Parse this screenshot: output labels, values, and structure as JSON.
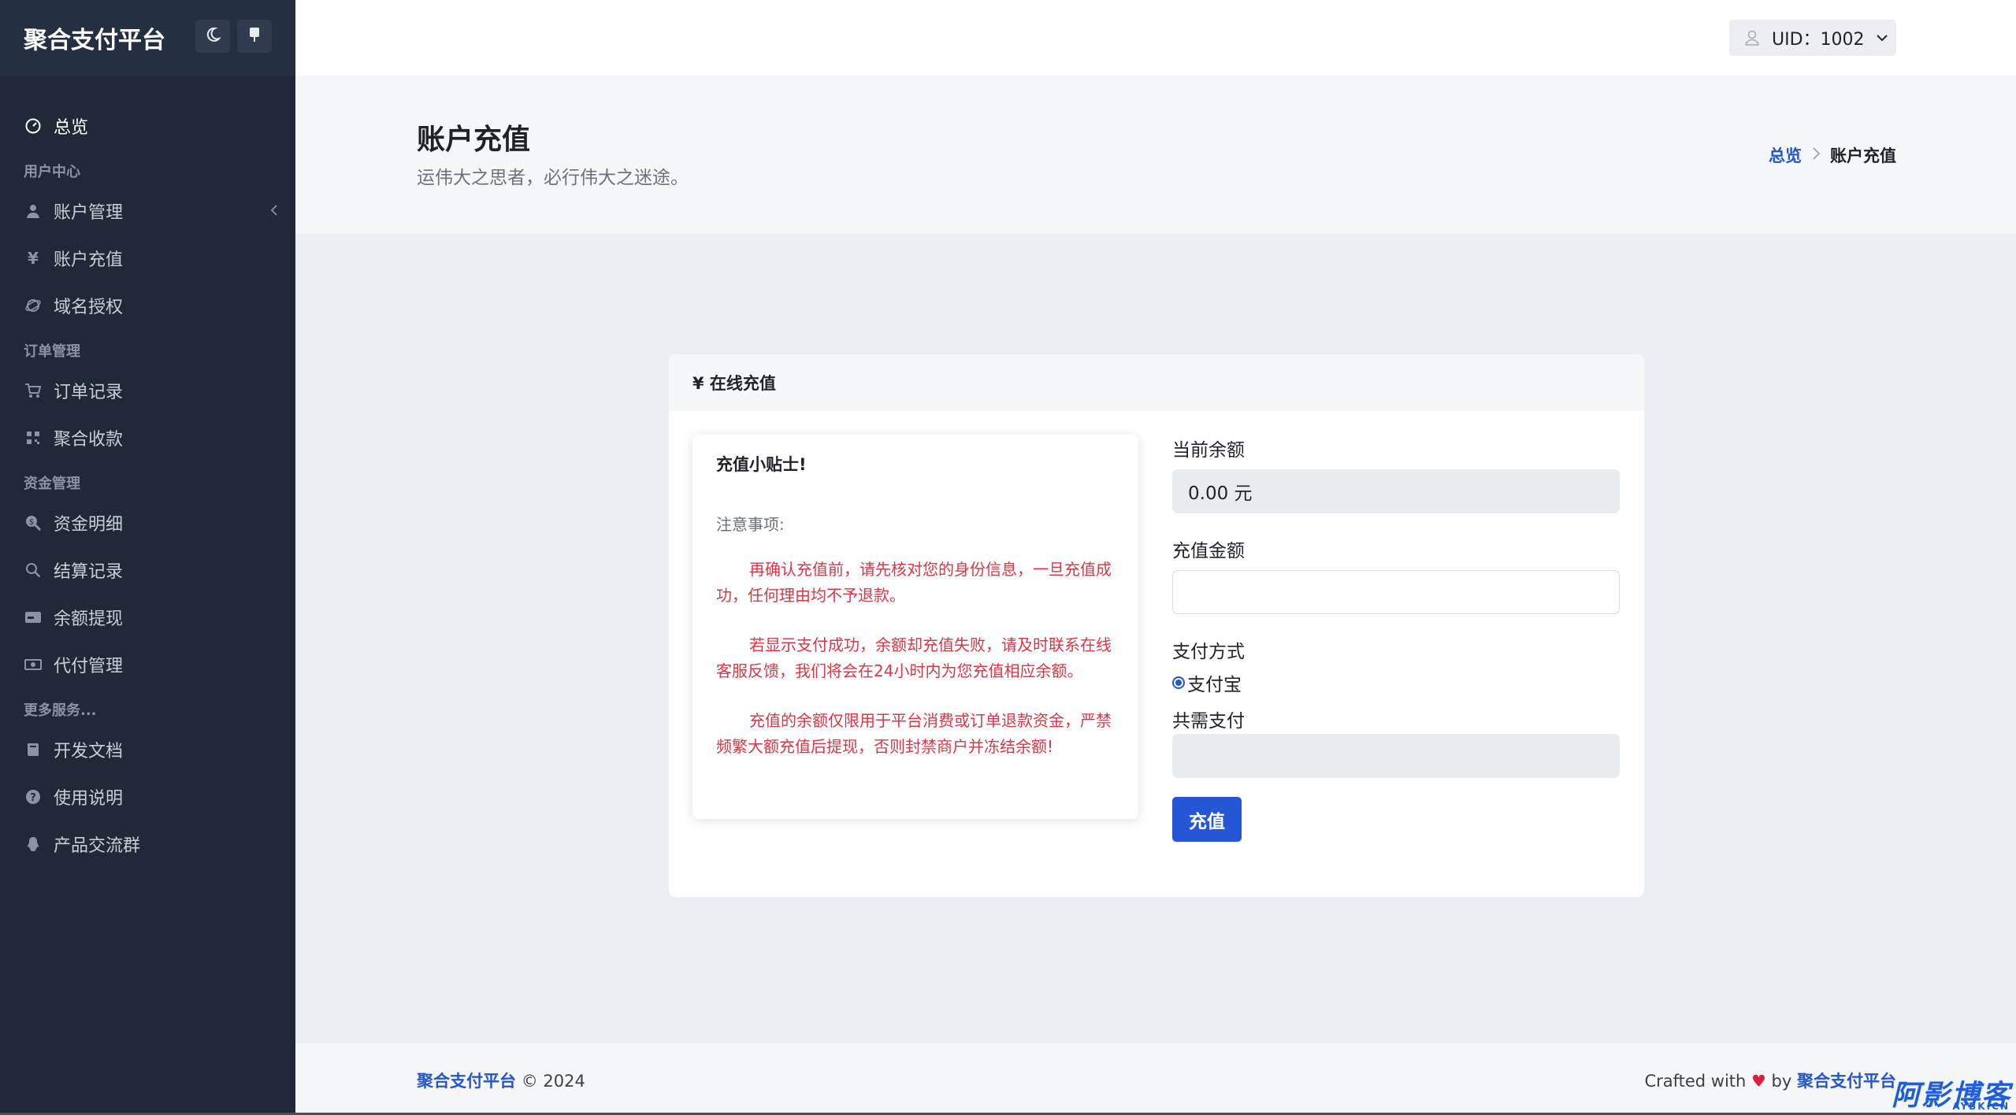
{
  "brand": "聚合支付平台",
  "sidebar": {
    "theme_icon": "moon-icon",
    "mobile_icon": "phone-icon",
    "items": [
      {
        "type": "item",
        "label": "总览",
        "icon": "dashboard-icon",
        "active": true
      },
      {
        "type": "head",
        "label": "用户中心"
      },
      {
        "type": "item",
        "label": "账户管理",
        "icon": "user-icon",
        "caret": true
      },
      {
        "type": "item",
        "label": "账户充值",
        "icon": "yen-icon"
      },
      {
        "type": "item",
        "label": "域名授权",
        "icon": "globe-icon"
      },
      {
        "type": "head",
        "label": "订单管理"
      },
      {
        "type": "item",
        "label": "订单记录",
        "icon": "cart-icon"
      },
      {
        "type": "item",
        "label": "聚合收款",
        "icon": "qrcode-icon"
      },
      {
        "type": "head",
        "label": "资金管理"
      },
      {
        "type": "item",
        "label": "资金明细",
        "icon": "search-dollar-icon"
      },
      {
        "type": "item",
        "label": "结算记录",
        "icon": "search-icon"
      },
      {
        "type": "item",
        "label": "余额提现",
        "icon": "card-icon"
      },
      {
        "type": "item",
        "label": "代付管理",
        "icon": "money-icon"
      },
      {
        "type": "head",
        "label": "更多服务..."
      },
      {
        "type": "item",
        "label": "开发文档",
        "icon": "book-icon"
      },
      {
        "type": "item",
        "label": "使用说明",
        "icon": "question-icon"
      },
      {
        "type": "item",
        "label": "产品交流群",
        "icon": "qq-icon"
      }
    ]
  },
  "header": {
    "user_label": "UID：1002"
  },
  "hero": {
    "title": "账户充值",
    "subtitle": "运伟大之思者，必行伟大之迷途。",
    "breadcrumb_home": "总览",
    "breadcrumb_current": "账户充值"
  },
  "card": {
    "title": "¥ 在线充值",
    "tips": {
      "title": "充值小贴士!",
      "note": "注意事项:",
      "paragraphs": [
        "再确认充值前，请先核对您的身份信息，一旦充值成功，任何理由均不予退款。",
        "若显示支付成功，余额却充值失败，请及时联系在线客服反馈，我们将会在24小时内为您充值相应余额。",
        "充值的余额仅限用于平台消费或订单退款资金，严禁频繁大额充值后提现，否则封禁商户并冻结余额!"
      ]
    },
    "form": {
      "balance_label": "当前余额",
      "balance_value": "0.00 元",
      "amount_label": "充值金额",
      "amount_value": "",
      "pay_method_label": "支付方式",
      "pay_method_option": "支付宝",
      "total_label": "共需支付",
      "total_value": "",
      "submit_label": "充值"
    }
  },
  "footer": {
    "brand": "聚合支付平台",
    "copyright": "© 2024",
    "crafted": "Crafted with",
    "by": "by",
    "brand_right": "聚合支付平台"
  },
  "watermark": {
    "text": "阿影博客",
    "sub": "AYBK.CN"
  }
}
